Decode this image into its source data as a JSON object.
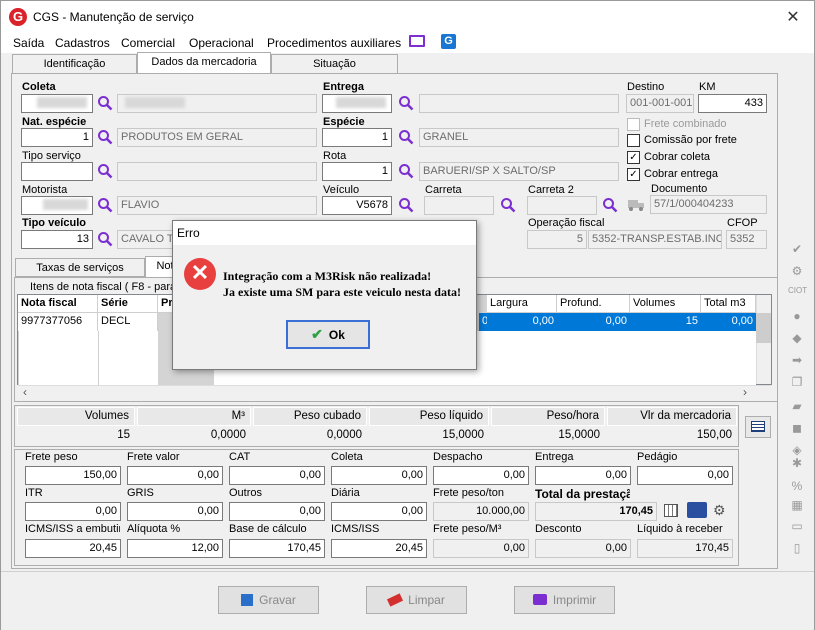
{
  "window": {
    "title": "CGS - Manutenção de serviço",
    "logo": "G",
    "close": "✕"
  },
  "menu": [
    "Saída",
    "Cadastros",
    "Comercial",
    "Operacional",
    "Procedimentos auxiliares"
  ],
  "menu_icons": {
    "monitor": "monitor-icon",
    "g": "G"
  },
  "tabs": [
    "Identificação",
    "Dados da mercadoria",
    "Situação"
  ],
  "form": {
    "coleta_label": "Coleta",
    "entrega_label": "Entrega",
    "destino_label": "Destino",
    "km_label": "KM",
    "destino_value": "001-001-001",
    "km_value": "433",
    "nat_especie_label": "Nat. espécie",
    "nat_especie_code": "1",
    "nat_especie_desc": "PRODUTOS EM GERAL",
    "especie_label": "Espécie",
    "especie_code": "1",
    "especie_desc": "GRANEL",
    "frete_combinado": "Frete combinado",
    "comissao_frete": "Comissão por frete",
    "cobrar_coleta": "Cobrar coleta",
    "cobrar_entrega": "Cobrar entrega",
    "tipo_servico_label": "Tipo serviço",
    "rota_label": "Rota",
    "rota_code": "1",
    "rota_desc": "BARUERI/SP X SALTO/SP",
    "motorista_label": "Motorista",
    "motorista_desc": "FLAVIO",
    "veiculo_label": "Veículo",
    "veiculo_value": "V5678",
    "carreta_label": "Carreta",
    "carreta2_label": "Carreta 2",
    "documento_label": "Documento",
    "documento_value": "57/1/000404233",
    "tipo_veiculo_label": "Tipo veículo",
    "tipo_veiculo_code": "13",
    "tipo_veiculo_desc": "CAVALO T",
    "operacao_fiscal_label": "Operação fiscal",
    "operacao_fiscal_code": "5",
    "operacao_fiscal_desc": "5352-TRANSP.ESTAB.INC",
    "cfop_label": "CFOP",
    "cfop_value": "5352"
  },
  "subtabs": [
    "Taxas de serviços",
    "Not"
  ],
  "items": {
    "group_label": "Itens de nota fiscal ( F8 - para",
    "headers": [
      "Nota fiscal",
      "Série",
      "Pr",
      "Largura",
      "Profund.",
      "Volumes",
      "Total m3"
    ],
    "row": [
      "9977377056",
      "DECL",
      "0,00",
      "0,00",
      "0,00",
      "15",
      "0,00"
    ]
  },
  "summary": {
    "headers": [
      "Volumes",
      "M³",
      "Peso cubado",
      "Peso líquido",
      "Peso/hora",
      "Vlr da mercadoria"
    ],
    "values": [
      "15",
      "0,0000",
      "0,0000",
      "15,0000",
      "15,0000",
      "150,00"
    ]
  },
  "charges": [
    {
      "label": "Frete peso",
      "value": "150,00"
    },
    {
      "label": "Frete valor",
      "value": "0,00"
    },
    {
      "label": "CAT",
      "value": "0,00"
    },
    {
      "label": "Coleta",
      "value": "0,00"
    },
    {
      "label": "Despacho",
      "value": "0,00"
    },
    {
      "label": "Entrega",
      "value": "0,00"
    },
    {
      "label": "Pedágio",
      "value": "0,00"
    },
    {
      "label": "ITR",
      "value": "0,00"
    },
    {
      "label": "GRIS",
      "value": "0,00"
    },
    {
      "label": "Outros",
      "value": "0,00"
    },
    {
      "label": "Diária",
      "value": "0,00"
    },
    {
      "label": "Frete peso/ton",
      "value": "10.000,00"
    },
    {
      "label": "Total da prestação",
      "value": "170,45"
    },
    {
      "label": "ICMS/ISS a embutir",
      "value": "20,45"
    },
    {
      "label": "Alíquota %",
      "value": "12,00"
    },
    {
      "label": "Base de cálculo",
      "value": "170,45"
    },
    {
      "label": "ICMS/ISS",
      "value": "20,45"
    },
    {
      "label": "Frete peso/M³",
      "value": "0,00"
    },
    {
      "label": "Desconto",
      "value": "0,00"
    },
    {
      "label": "Líquido à receber",
      "value": "170,45"
    }
  ],
  "buttons": {
    "gravar": "Gravar",
    "limpar": "Limpar",
    "imprimir": "Imprimir"
  },
  "dialog": {
    "title": "Erro",
    "line1": "Integração com a M3Risk não realizada!",
    "line2": "Ja existe uma SM para este veiculo nesta data!",
    "ok": "Ok",
    "icon": "✕"
  },
  "colors": {
    "accent": "#7b2fd1",
    "selection": "#0078d7",
    "error": "#e8403f",
    "logo": "#d9222a"
  }
}
